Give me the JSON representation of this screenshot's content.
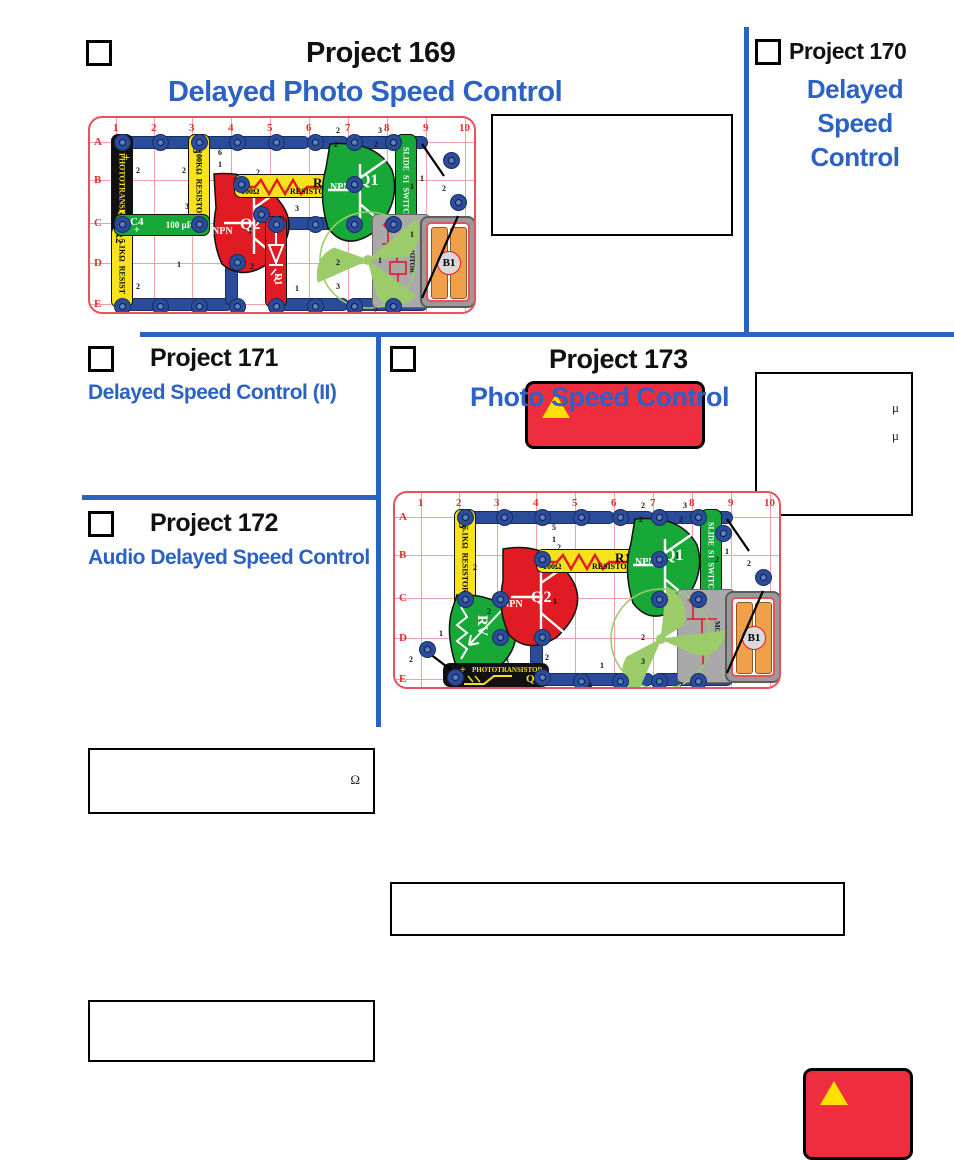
{
  "page": {
    "background": "#ffffff",
    "divider_color": "#2B62C4",
    "title_color": "#111111",
    "subtitle_color": "#2B62C4",
    "warning_fill": "#EE2E3E",
    "warning_triangle": "#FFE000",
    "board_border": "#E8505B",
    "board_grid": "#F4A0A6",
    "wire_color": "#2B4C9B"
  },
  "projects": [
    {
      "id": "169",
      "checkbox_label": "",
      "title": "Project 169",
      "subtitle": "Delayed Photo Speed Control",
      "notes_box": "",
      "warning_icon": "warning-triangle-icon"
    },
    {
      "id": "170",
      "title": "Project 170",
      "subtitle_lines": [
        "Delayed",
        "Speed",
        "Control"
      ],
      "notes_units": [
        "μ",
        "μ"
      ]
    },
    {
      "id": "171",
      "title": "Project 171",
      "subtitle": "Delayed Speed Control (II)",
      "notes_units": [
        "Ω"
      ]
    },
    {
      "id": "172",
      "title": "Project 172",
      "subtitle": "Audio Delayed Speed Control",
      "notes_box": ""
    },
    {
      "id": "173",
      "title": "Project 173",
      "subtitle": "Photo Speed Control",
      "notes_box": "",
      "warning_icon": "warning-triangle-icon"
    }
  ],
  "board169": {
    "columns": [
      "1",
      "2",
      "3",
      "4",
      "5",
      "6",
      "7",
      "8",
      "9",
      "10"
    ],
    "rows": [
      "A",
      "B",
      "C",
      "D",
      "E"
    ],
    "parts": [
      {
        "ref": "Q4",
        "name": "PHOTOTRANSISTOR",
        "color": "black",
        "plus": "+"
      },
      {
        "ref": "R5",
        "name": "RESISTOR",
        "value": "100KΩ",
        "color": "yellow"
      },
      {
        "ref": "C4",
        "name": "CAPACITOR",
        "value": "100 µF",
        "color": "green",
        "plus": "+"
      },
      {
        "ref": "R2",
        "name": "RESIST",
        "value": "5.1KΩ",
        "color": "yellow"
      },
      {
        "ref": "R1",
        "name": "RESISTOR",
        "value": "100Ω",
        "color": "yellow"
      },
      {
        "ref": "Q2",
        "name": "NPN",
        "color": "red"
      },
      {
        "ref": "Q1",
        "name": "NPN",
        "color": "green"
      },
      {
        "ref": "S1",
        "name": "SLIDE SWITCH",
        "color": "green"
      },
      {
        "ref": "D1",
        "name": "LED",
        "color": "red",
        "plus": "+"
      },
      {
        "ref": "B1",
        "name": "BATTERY",
        "color": "grey"
      },
      {
        "ref": "M1",
        "name": "MOTOR",
        "color": "grey"
      }
    ],
    "snap_numbers": [
      "1",
      "2",
      "3",
      "4",
      "5",
      "6"
    ]
  },
  "board173": {
    "columns": [
      "1",
      "2",
      "3",
      "4",
      "5",
      "6",
      "7",
      "8",
      "9",
      "10"
    ],
    "rows": [
      "A",
      "B",
      "C",
      "D",
      "E"
    ],
    "parts": [
      {
        "ref": "R3",
        "name": "RESISTOR",
        "value": "5.1KΩ",
        "color": "yellow"
      },
      {
        "ref": "RV",
        "name": "VARIABLE RESISTOR",
        "color": "green"
      },
      {
        "ref": "Q2",
        "name": "NPN",
        "color": "red"
      },
      {
        "ref": "R1",
        "name": "RESISTOR",
        "value": "100Ω",
        "color": "yellow"
      },
      {
        "ref": "Q1",
        "name": "NPN",
        "color": "green"
      },
      {
        "ref": "S1",
        "name": "SLIDE SWITCH",
        "color": "green"
      },
      {
        "ref": "Q4",
        "name": "PHOTOTRANSISTOR",
        "color": "black",
        "plus": "+"
      },
      {
        "ref": "B1",
        "name": "BATTERY",
        "color": "grey"
      },
      {
        "ref": "M1",
        "name": "MOTOR",
        "color": "grey"
      }
    ]
  }
}
